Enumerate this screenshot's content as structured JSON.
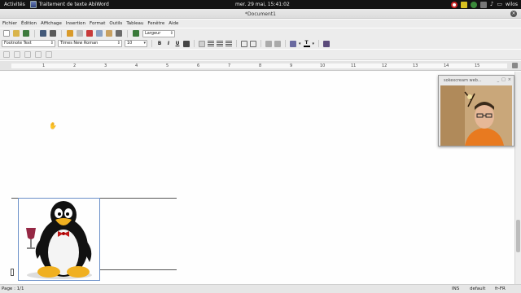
{
  "topbar": {
    "activities": "Activités",
    "app_name": "Traitement de texte AbiWord",
    "clock": "mer. 29 mai, 15:41:02",
    "user": "wilos",
    "tray_icons": [
      "record-icon",
      "warning-icon",
      "network-icon",
      "keyboard-icon",
      "volume-icon",
      "battery-icon"
    ]
  },
  "window": {
    "title": "*Document1",
    "close_glyph": "×"
  },
  "menu": [
    "Fichier",
    "Édition",
    "Affichage",
    "Insertion",
    "Format",
    "Outils",
    "Tableau",
    "Fenêtre",
    "Aide"
  ],
  "toolbar_format": {
    "zoom_value": "Largeur"
  },
  "format_bar": {
    "style_value": "Footnote Text",
    "font_value": "Times New Roman",
    "size_value": "10",
    "bold": "B",
    "italic": "I",
    "underline": "U",
    "text_color_glyph": "T"
  },
  "ruler": {
    "ticks": [
      "1",
      "2",
      "3",
      "4",
      "5",
      "6",
      "7",
      "8",
      "9",
      "10",
      "11",
      "12",
      "13",
      "14",
      "15"
    ]
  },
  "webcam": {
    "title": "sokexcream web...",
    "buttons": [
      "_",
      "□",
      "×"
    ]
  },
  "statusbar": {
    "page": "Page : 1/1",
    "mode": "INS",
    "style": "default",
    "lang": "fr-FR"
  },
  "colors": {
    "topbar_bg": "#141414",
    "toolbar_bg": "#ececec",
    "selection_frame": "#6a8fc8"
  }
}
